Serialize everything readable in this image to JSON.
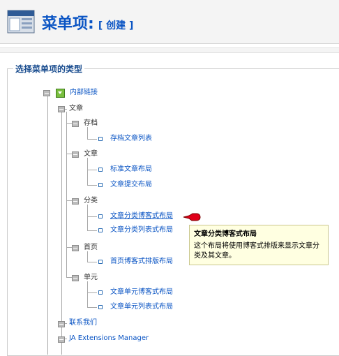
{
  "header": {
    "title": "菜单项:",
    "action": "[ 创建 ]",
    "icon": "menu-icon"
  },
  "panel": {
    "legend": "选择菜单项的类型"
  },
  "tree": {
    "root": {
      "label": "内部链接",
      "icon": "folder-open-icon"
    },
    "wenzhang": "文章",
    "archive": {
      "label": "存档",
      "items": [
        "存档文章列表"
      ]
    },
    "article": {
      "label": "文章",
      "items": [
        "标准文章布局",
        "文章提交布局"
      ]
    },
    "category": {
      "label": "分类",
      "items": [
        "文章分类博客式布局",
        "文章分类列表式布局"
      ]
    },
    "frontpage": {
      "label": "首页",
      "items": [
        "首页博客式排版布局"
      ]
    },
    "section": {
      "label": "单元",
      "items": [
        "文章单元博客式布局",
        "文章单元列表式布局"
      ]
    },
    "contact": "联系我们",
    "ja": "JA Extensions Manager"
  },
  "tooltip": {
    "title": "文章分类博客式布局",
    "body": "这个布局将使用博客式排版来显示文章分类及其文章。"
  },
  "colors": {
    "link": "#0b55c4",
    "tooltip_bg": "#ffffe1"
  }
}
